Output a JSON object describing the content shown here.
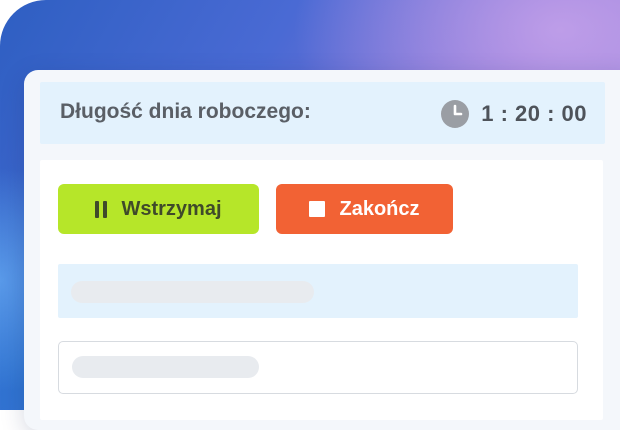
{
  "header": {
    "label": "Długość dnia roboczego:",
    "timer": "1 : 20 : 00",
    "icon": "clock-icon"
  },
  "actions": {
    "pause_label": "Wstrzymaj",
    "pause_icon": "pause-icon",
    "end_label": "Zakończ",
    "end_icon": "stop-icon"
  },
  "colors": {
    "pause_button": "#b6e629",
    "end_button": "#f26234",
    "header_background": "#e3f2fd"
  }
}
